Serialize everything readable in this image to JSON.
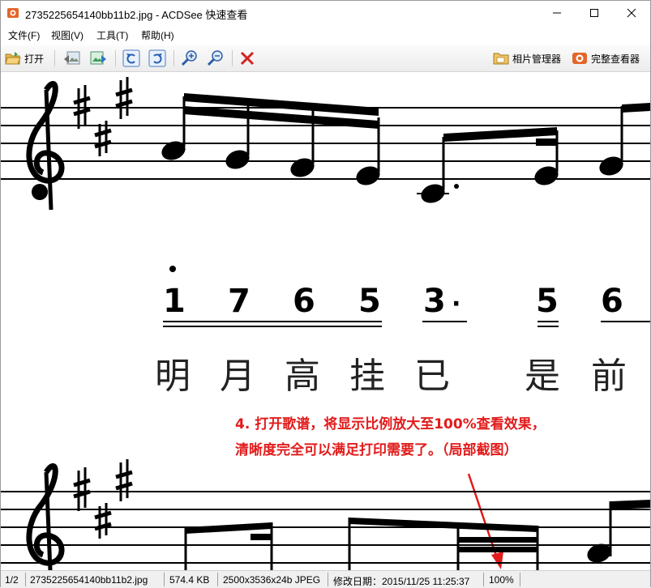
{
  "window": {
    "title": "2735225654140bb11b2.jpg - ACDSee 快速查看"
  },
  "menu": [
    "文件(F)",
    "视图(V)",
    "工具(T)",
    "帮助(H)"
  ],
  "toolbar": {
    "open_label": "打开",
    "photo_manager_label": "相片管理器",
    "full_viewer_label": "完整查看器"
  },
  "score": {
    "jianpu": [
      "1",
      "7",
      "6",
      "5",
      "3",
      "·",
      "5",
      "6"
    ],
    "lyrics": [
      "明",
      "月",
      "高",
      "挂",
      "已",
      "是",
      "前"
    ]
  },
  "annotation": {
    "line1": "4. 打开歌谱，将显示比例放大至100%查看效果，",
    "line2": "清晰度完全可以满足打印需要了。（局部截图）",
    "color": "#e21b1b"
  },
  "status": {
    "page": "1/2",
    "filename": "2735225654140bb11b2.jpg",
    "filesize": "574.4 KB",
    "dimensions": "2500x3536x24b JPEG",
    "modified": "修改日期：2015/11/25 11:25:37",
    "zoom": "100%"
  }
}
